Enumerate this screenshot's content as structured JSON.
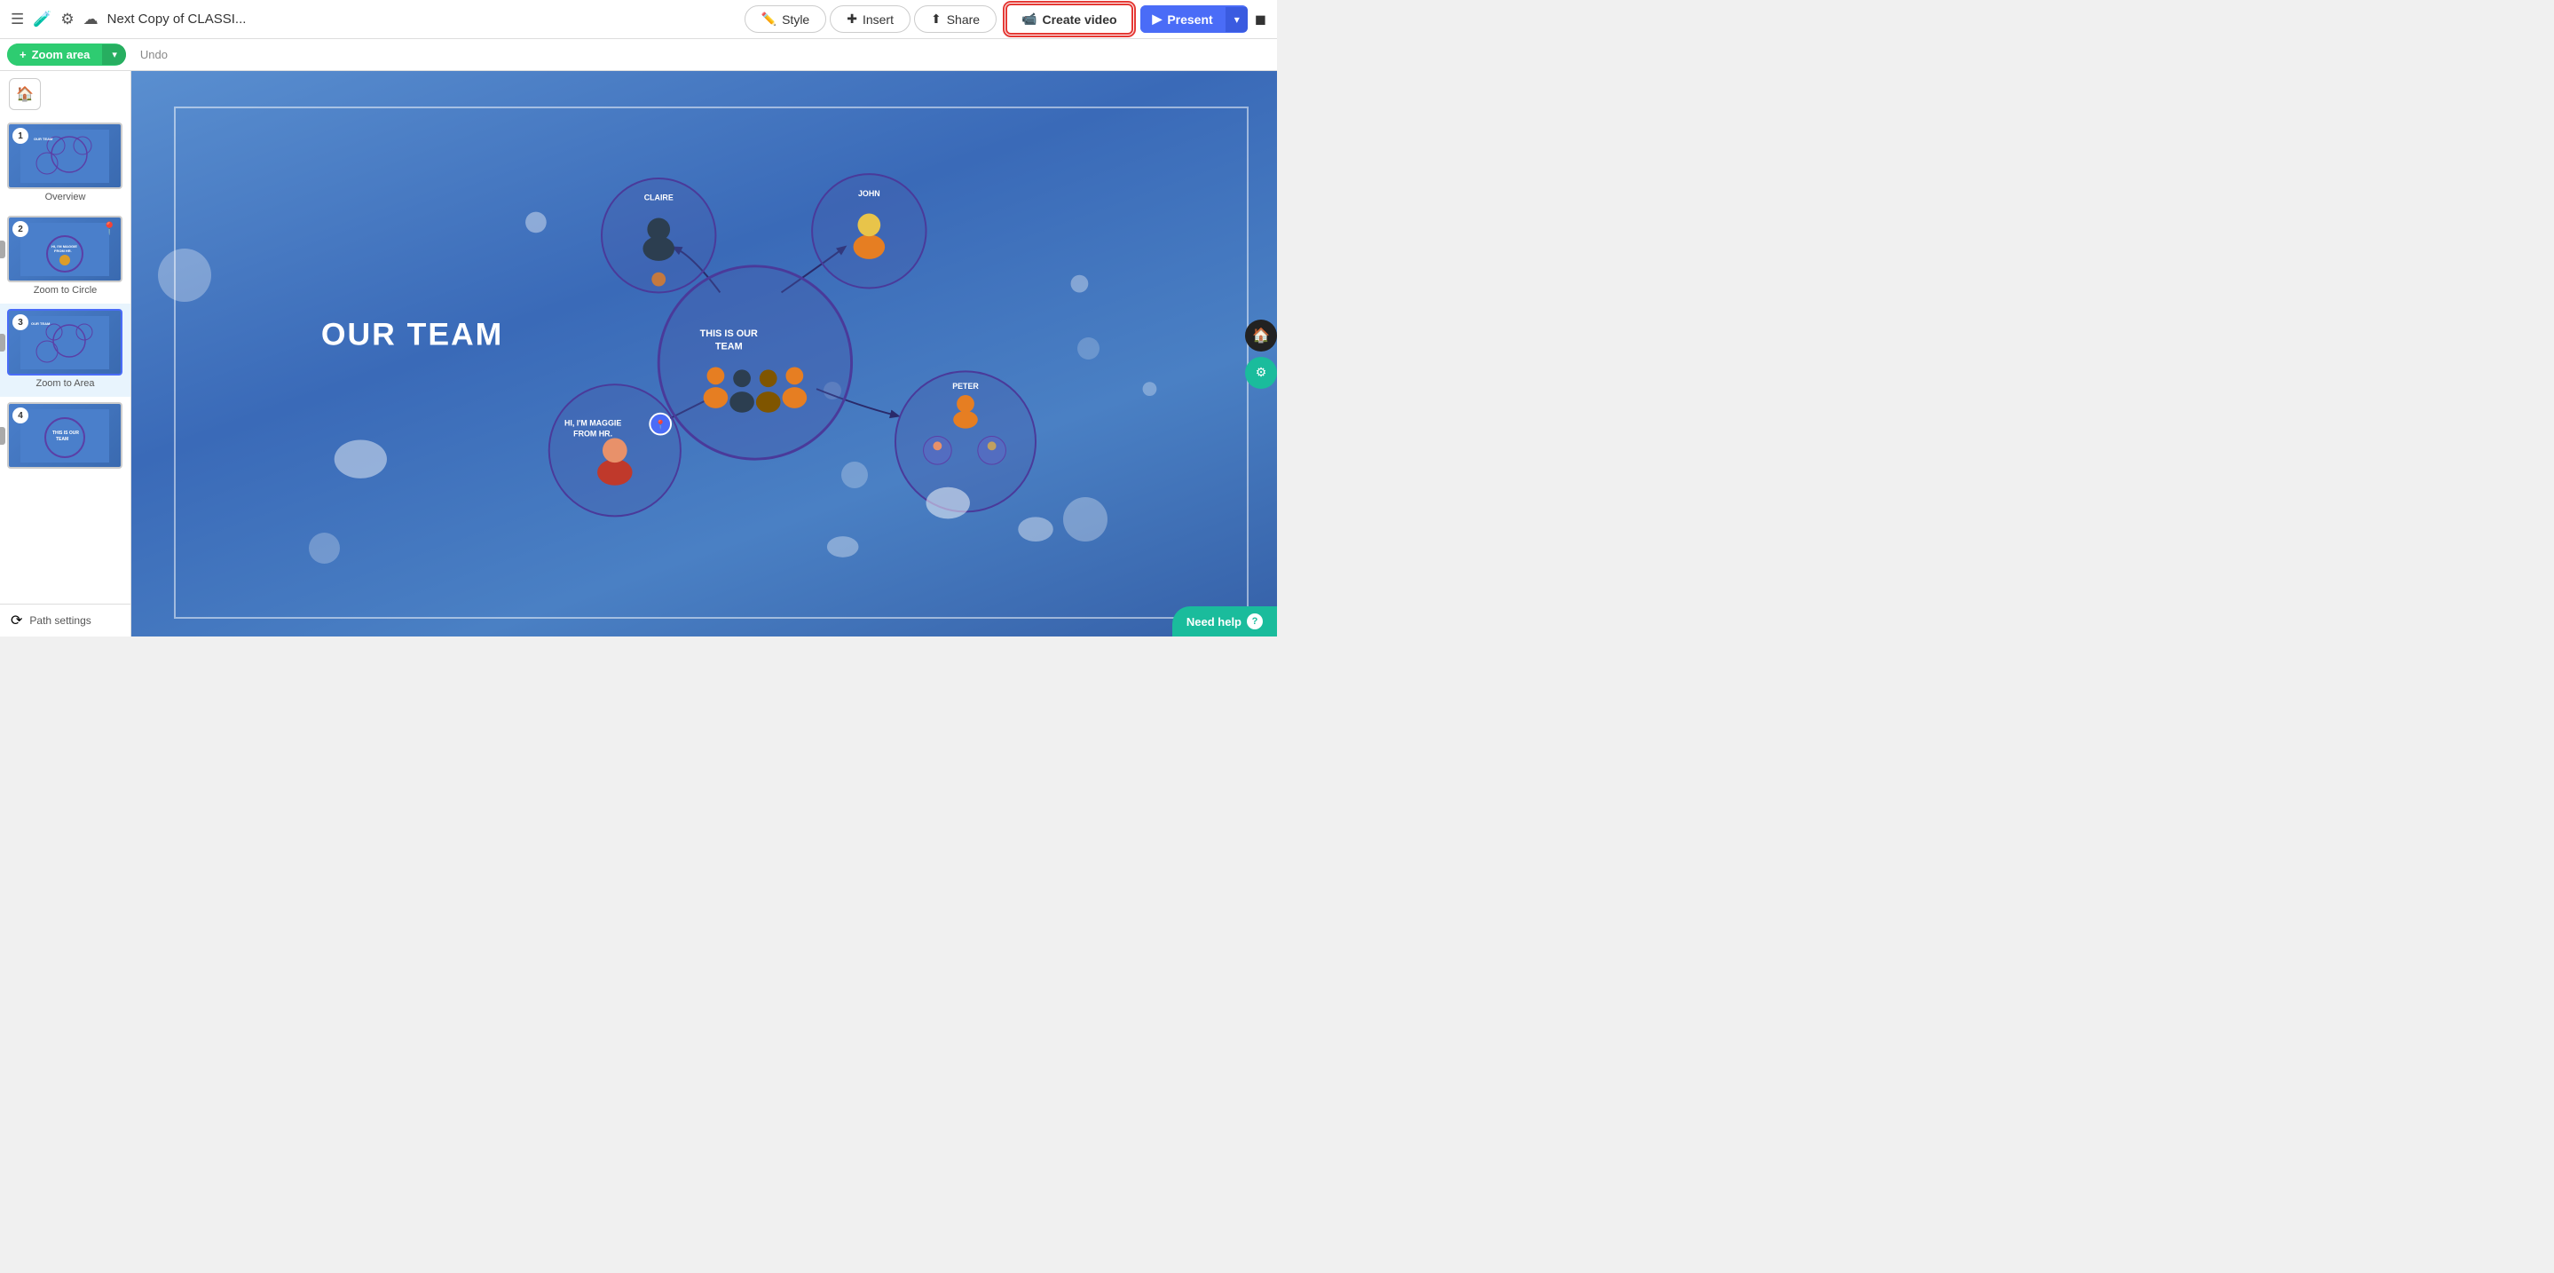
{
  "topbar": {
    "title": "Next Copy of CLASSI...",
    "style_label": "Style",
    "insert_label": "Insert",
    "share_label": "Share",
    "create_video_label": "Create video",
    "present_label": "Present",
    "hamburger_icon": "☰",
    "flask_icon": "🧪",
    "gear_icon": "⚙",
    "cloud_icon": "☁",
    "chat_icon": "💬",
    "play_icon": "▶",
    "camera_icon": "📹",
    "chevron_down": "▾"
  },
  "toolbar": {
    "zoom_area_label": "Zoom area",
    "plus_icon": "+",
    "chevron_down": "▾",
    "undo_label": "Undo"
  },
  "sidebar": {
    "home_icon": "🏠",
    "slides": [
      {
        "num": "1",
        "label": "Overview",
        "selected": false
      },
      {
        "num": "2",
        "label": "Zoom to Circle",
        "selected": false,
        "has_pin": true
      },
      {
        "num": "3",
        "label": "Zoom to Area",
        "selected": true
      },
      {
        "num": "4",
        "label": "",
        "selected": false
      }
    ],
    "path_settings_label": "Path settings",
    "path_icon": "⟳"
  },
  "canvas": {
    "our_team_text": "OUR TEAM",
    "main_circle_text": "THIS IS OUR\nTEAM",
    "claire_label": "CLAIRE",
    "john_label": "JOHN",
    "maggie_label": "HI, I'M MAGGIE\nFROM HR.",
    "peter_label": "PETER"
  },
  "right_sidebar": {
    "home_icon": "🏠",
    "settings_icon": "⚙"
  },
  "need_help": {
    "label": "Need help",
    "icon": "?"
  }
}
